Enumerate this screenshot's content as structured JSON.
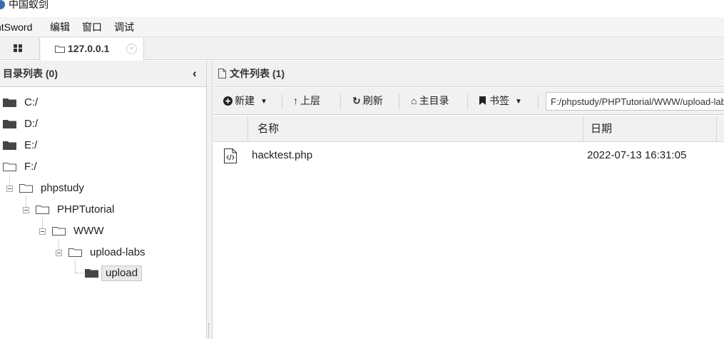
{
  "window": {
    "title": "中国蚁剑"
  },
  "menu": {
    "items": [
      "ntSword",
      "编辑",
      "窗口",
      "调试"
    ]
  },
  "tabs": {
    "active_label": "127.0.0.1",
    "close_glyph": "×"
  },
  "left_panel": {
    "title": "目录列表 (0)",
    "collapse_glyph": "‹",
    "drives": [
      "C:/",
      "D:/",
      "E:/",
      "F:/"
    ],
    "tree": [
      "phpstudy",
      "PHPTutorial",
      "WWW",
      "upload-labs",
      "upload"
    ],
    "selected": "upload"
  },
  "right_panel": {
    "title": "文件列表 (1)",
    "toolbar": {
      "new_label": "新建",
      "up_label": "上层",
      "refresh_label": "刷新",
      "home_label": "主目录",
      "bookmark_label": "书签",
      "path_value": "F:/phpstudy/PHPTutorial/WWW/upload-labs/upload/"
    },
    "columns": {
      "name": "名称",
      "date": "日期"
    },
    "files": [
      {
        "name": "hacktest.php",
        "date": "2022-07-13 16:31:05"
      }
    ]
  }
}
